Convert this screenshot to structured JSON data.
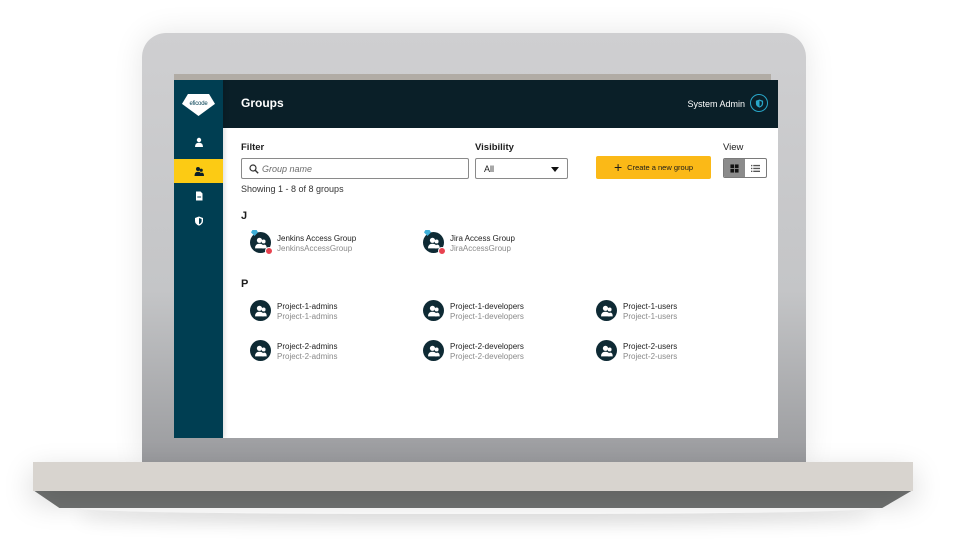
{
  "app": {
    "logo_text": "eficode"
  },
  "sidebar": {
    "items": [
      {
        "name": "users",
        "icon": "user-icon",
        "active": false
      },
      {
        "name": "groups",
        "icon": "users-group-icon",
        "active": true
      },
      {
        "name": "documents",
        "icon": "document-icon",
        "active": false
      },
      {
        "name": "security",
        "icon": "shield-icon",
        "active": false
      }
    ]
  },
  "header": {
    "title": "Groups",
    "user_name": "System Admin",
    "user_icon": "shield-avatar-icon"
  },
  "filters": {
    "filter_label": "Filter",
    "search_placeholder": "Group name",
    "search_value": "",
    "visibility_label": "Visibility",
    "visibility_value": "All",
    "view_label": "View",
    "view_modes": [
      "grid",
      "list"
    ],
    "active_view": "grid",
    "create_button_label": "Create a new group",
    "showing_text": "Showing 1 - 8 of 8 groups"
  },
  "colors": {
    "sidebar_bg": "#003e52",
    "header_bg": "#0a1f28",
    "accent_yellow": "#fccb14",
    "button_yellow": "#fbb917",
    "badge_blue": "#3fb0d9",
    "badge_red": "#e8424f",
    "user_icon_ring": "#29a7c9"
  },
  "sections": [
    {
      "letter": "J",
      "groups": [
        {
          "name": "Jenkins Access Group",
          "id": "JenkinsAccessGroup",
          "badges": true
        },
        {
          "name": "Jira Access Group",
          "id": "JiraAccessGroup",
          "badges": true
        }
      ]
    },
    {
      "letter": "P",
      "groups": [
        {
          "name": "Project-1-admins",
          "id": "Project-1-admins",
          "badges": false
        },
        {
          "name": "Project-1-developers",
          "id": "Project-1-developers",
          "badges": false
        },
        {
          "name": "Project-1-users",
          "id": "Project-1-users",
          "badges": false
        },
        {
          "name": "Project-2-admins",
          "id": "Project-2-admins",
          "badges": false
        },
        {
          "name": "Project-2-developers",
          "id": "Project-2-developers",
          "badges": false
        },
        {
          "name": "Project-2-users",
          "id": "Project-2-users",
          "badges": false
        }
      ]
    }
  ]
}
